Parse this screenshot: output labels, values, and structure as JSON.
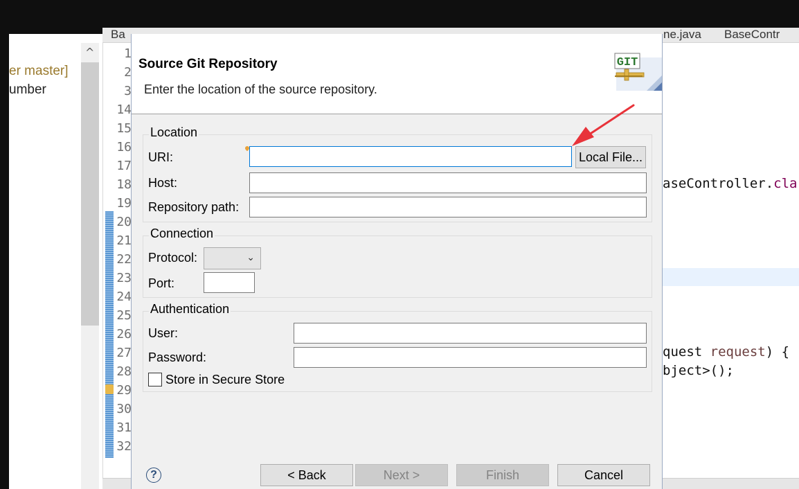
{
  "background_editor": {
    "tabs": [
      "Ba",
      "ne.java",
      "BaseContr"
    ],
    "package_explorer": {
      "branch_text": "er master]",
      "number_text": "umber"
    },
    "line_numbers": [
      "1",
      "2",
      "3",
      "14",
      "15",
      "16",
      "17",
      "18",
      "19",
      "20",
      "21",
      "22",
      "23",
      "24",
      "25",
      "26",
      "27",
      "28",
      "29",
      "30",
      "31",
      "32"
    ],
    "code": {
      "line18_main": "aseController.",
      "line18_keyword": "cla",
      "line27_a": "quest ",
      "line27_param": "request",
      "line27_b": ") {",
      "line28": "bject>();"
    }
  },
  "dialog": {
    "title": "Source Git Repository",
    "description": "Enter the location of the source repository.",
    "logo_text": "GIT",
    "location": {
      "group_label": "Location",
      "uri_label": "URI:",
      "uri_value": "",
      "local_file_button": "Local File...",
      "host_label": "Host:",
      "host_value": "",
      "repo_path_label": "Repository path:",
      "repo_path_value": ""
    },
    "connection": {
      "group_label": "Connection",
      "protocol_label": "Protocol:",
      "protocol_value": "",
      "port_label": "Port:",
      "port_value": ""
    },
    "authentication": {
      "group_label": "Authentication",
      "user_label": "User:",
      "user_value": "",
      "password_label": "Password:",
      "password_value": "",
      "store_label": "Store in Secure Store",
      "store_checked": false
    },
    "buttons": {
      "help": "?",
      "back": "< Back",
      "next": "Next >",
      "finish": "Finish",
      "cancel": "Cancel"
    }
  },
  "colors": {
    "annotation_arrow": "#e8333a",
    "focus_border": "#0078d7",
    "dialog_bg": "#f0f0f0"
  }
}
